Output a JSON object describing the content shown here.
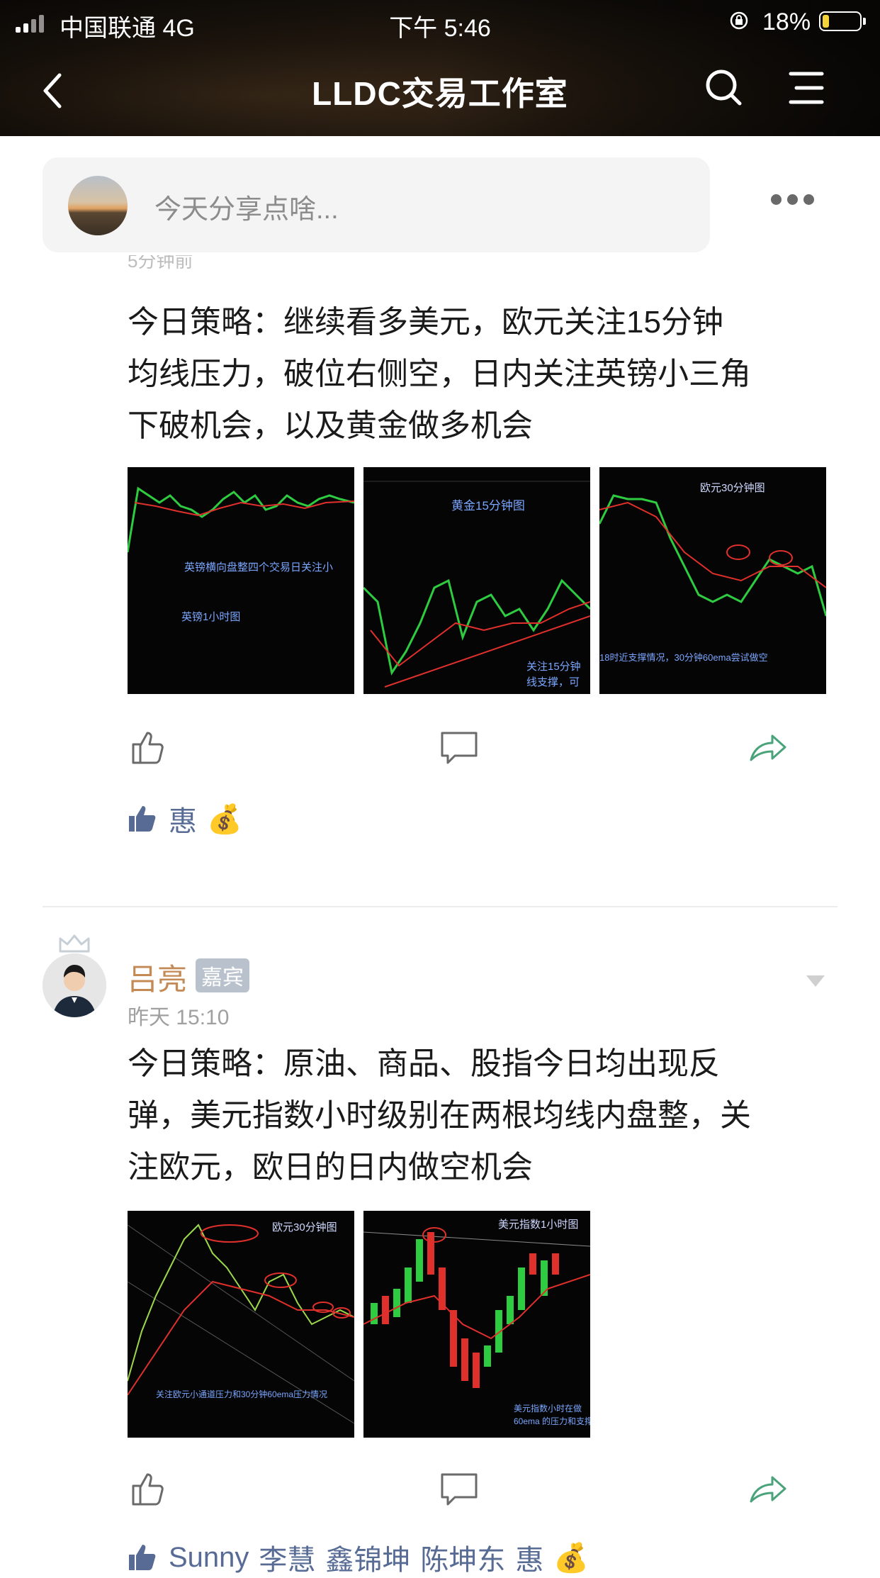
{
  "status_bar": {
    "carrier": "中国联通 4G",
    "time": "下午 5:46",
    "battery": "18%"
  },
  "nav": {
    "title": "LLDC交易工作室"
  },
  "composer": {
    "placeholder": "今天分享点啥..."
  },
  "posts": [
    {
      "partial_time": "5分钟前",
      "text_lines": [
        "今日策略：继续看多美元，欧元关注15分钟",
        "均线压力，破位右侧空，日内关注英镑小三角",
        "下破机会，以及黄金做多机会"
      ],
      "images": [
        {
          "captions": [
            "英镑横向盘整四个交易日关注小",
            "英镑1小时图"
          ]
        },
        {
          "captions": [
            "黄金15分钟图",
            "关注15分钟",
            "线支撑，可"
          ]
        },
        {
          "captions": [
            "欧元30分钟图",
            "18时近支撑情况，30分钟60ema尝试做空"
          ]
        }
      ],
      "likes": [
        "惠",
        "💰"
      ]
    },
    {
      "author": "吕亮",
      "badge": "嘉宾",
      "time": "昨天 15:10",
      "text_lines": [
        "今日策略：原油、商品、股指今日均出现反",
        "弹，美元指数小时级别在两根均线内盘整，关",
        "注欧元，欧日的日内做空机会"
      ],
      "images": [
        {
          "captions": [
            "欧元30分钟图",
            "关注欧元小通道压力和30分钟60ema压力情况"
          ]
        },
        {
          "captions": [
            "美元指数1小时图",
            "美元指数小时在做",
            "60ema 的压力和支撑"
          ]
        }
      ],
      "likes": [
        "Sunny",
        "李慧",
        "鑫锦坤",
        "陈坤东",
        "惠",
        "💰"
      ]
    }
  ],
  "colors": {
    "link": "#576b95",
    "author": "#c48a55",
    "share": "#4aa37a"
  }
}
